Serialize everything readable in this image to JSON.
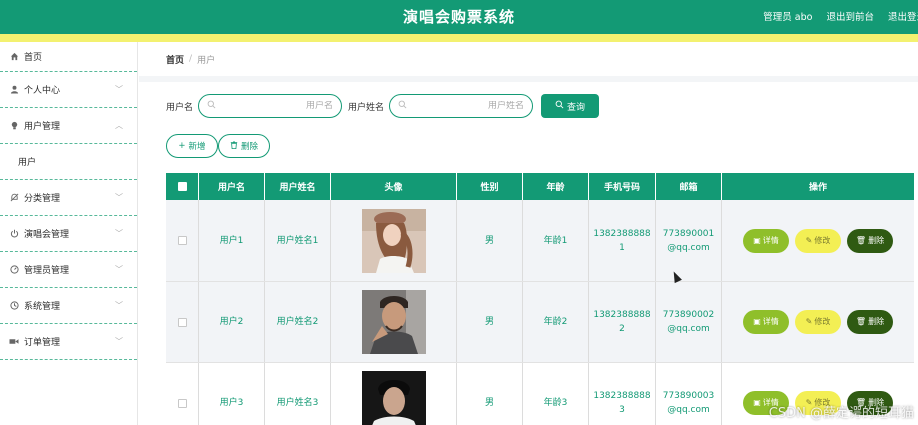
{
  "header": {
    "title": "演唱会购票系统",
    "admin_label": "管理员 abo",
    "to_front": "退出到前台",
    "logout": "退出登录"
  },
  "sidebar": {
    "items": [
      {
        "label": "首页",
        "icon": "home-icon"
      },
      {
        "label": "个人中心",
        "icon": "user-icon"
      },
      {
        "label": "用户管理",
        "icon": "bulb-icon",
        "expanded": true,
        "children": [
          {
            "label": "用户"
          }
        ]
      },
      {
        "label": "分类管理",
        "icon": "bell-off-icon"
      },
      {
        "label": "演唱会管理",
        "icon": "power-icon"
      },
      {
        "label": "管理员管理",
        "icon": "gauge-icon"
      },
      {
        "label": "系统管理",
        "icon": "clock-icon"
      },
      {
        "label": "订单管理",
        "icon": "video-icon"
      }
    ]
  },
  "breadcrumb": {
    "home": "首页",
    "separator": "/",
    "current": "用户"
  },
  "search": {
    "username_label": "用户名",
    "username_placeholder": "用户名",
    "realname_label": "用户姓名",
    "realname_placeholder": "用户姓名",
    "button": "查询"
  },
  "actions": {
    "add": "新增",
    "delete": "删除"
  },
  "table": {
    "headers": [
      "用户名",
      "用户姓名",
      "头像",
      "性别",
      "年龄",
      "手机号码",
      "邮箱",
      "操作"
    ],
    "rows": [
      {
        "username": "用户1",
        "realname": "用户姓名1",
        "gender": "男",
        "age": "年龄1",
        "phone_l1": "1382388888",
        "phone_l2": "1",
        "email_l1": "773890001",
        "email_l2": "@qq.com"
      },
      {
        "username": "用户2",
        "realname": "用户姓名2",
        "gender": "男",
        "age": "年龄2",
        "phone_l1": "1382388888",
        "phone_l2": "2",
        "email_l1": "773890002",
        "email_l2": "@qq.com"
      },
      {
        "username": "用户3",
        "realname": "用户姓名3",
        "gender": "男",
        "age": "年龄3",
        "phone_l1": "1382388888",
        "phone_l2": "3",
        "email_l1": "773890003",
        "email_l2": "@qq.com"
      }
    ],
    "row_actions": {
      "detail": "详情",
      "edit": "修改",
      "delete": "删除"
    }
  },
  "watermark": "CSDN @薛定谔的短耳猫",
  "colors": {
    "primary": "#139a75",
    "strip": "#f3f170",
    "detail": "#8fbf2a",
    "edit": "#f3ef54",
    "delete": "#2f5a12"
  }
}
